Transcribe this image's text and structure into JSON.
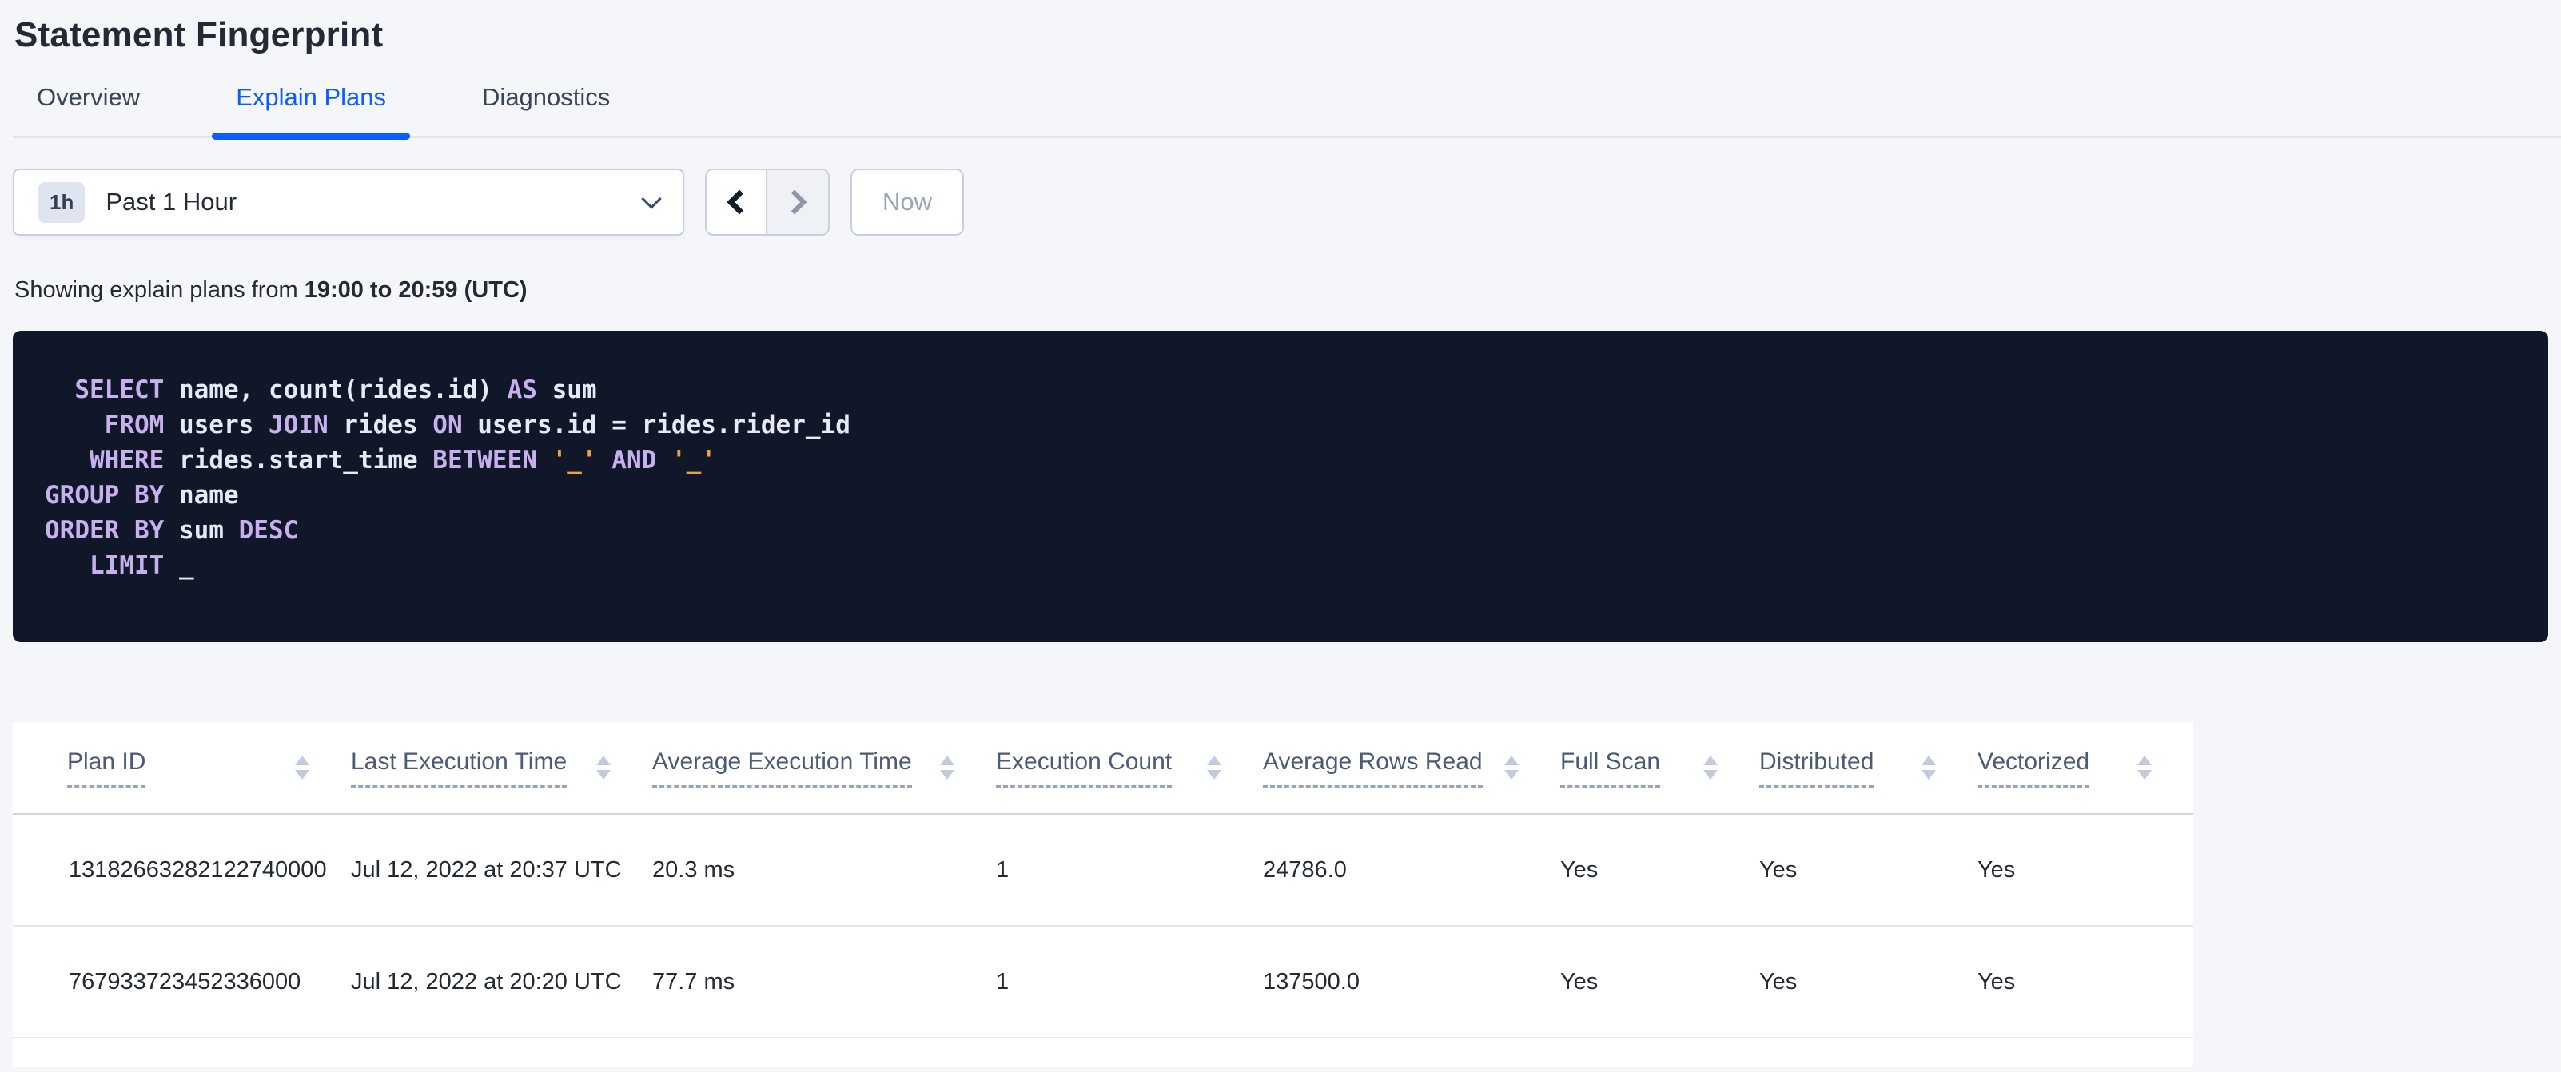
{
  "page": {
    "title": "Statement Fingerprint"
  },
  "tabs": [
    {
      "label": "Overview",
      "active": false
    },
    {
      "label": "Explain Plans",
      "active": true
    },
    {
      "label": "Diagnostics",
      "active": false
    }
  ],
  "time_picker": {
    "badge": "1h",
    "label": "Past 1 Hour",
    "now_label": "Now"
  },
  "subtitle": {
    "prefix": "Showing explain plans from ",
    "range": "19:00 to 20:59 (UTC)"
  },
  "sql": {
    "lines": [
      [
        {
          "t": "  ",
          "c": "pl"
        },
        {
          "t": "SELECT",
          "c": "kw"
        },
        {
          "t": " name, count(rides.id) ",
          "c": "pl"
        },
        {
          "t": "AS",
          "c": "kw"
        },
        {
          "t": " sum",
          "c": "pl"
        }
      ],
      [
        {
          "t": "    ",
          "c": "pl"
        },
        {
          "t": "FROM",
          "c": "kw"
        },
        {
          "t": " users ",
          "c": "pl"
        },
        {
          "t": "JOIN",
          "c": "kw"
        },
        {
          "t": " rides ",
          "c": "pl"
        },
        {
          "t": "ON",
          "c": "kw"
        },
        {
          "t": " users.id = rides.rider_id",
          "c": "pl"
        }
      ],
      [
        {
          "t": "   ",
          "c": "pl"
        },
        {
          "t": "WHERE",
          "c": "kw"
        },
        {
          "t": " rides.start_time ",
          "c": "pl"
        },
        {
          "t": "BETWEEN",
          "c": "kw"
        },
        {
          "t": " ",
          "c": "pl"
        },
        {
          "t": "'_'",
          "c": "lit"
        },
        {
          "t": " ",
          "c": "pl"
        },
        {
          "t": "AND",
          "c": "kw"
        },
        {
          "t": " ",
          "c": "pl"
        },
        {
          "t": "'_'",
          "c": "lit"
        }
      ],
      [
        {
          "t": "GROUP BY",
          "c": "kw"
        },
        {
          "t": " name",
          "c": "pl"
        }
      ],
      [
        {
          "t": "ORDER BY",
          "c": "kw"
        },
        {
          "t": " sum ",
          "c": "pl"
        },
        {
          "t": "DESC",
          "c": "kw"
        }
      ],
      [
        {
          "t": "   ",
          "c": "pl"
        },
        {
          "t": "LIMIT",
          "c": "kw"
        },
        {
          "t": " _",
          "c": "pl"
        }
      ]
    ]
  },
  "table": {
    "columns": [
      "Plan ID",
      "Last Execution Time",
      "Average Execution Time",
      "Execution Count",
      "Average Rows Read",
      "Full Scan",
      "Distributed",
      "Vectorized"
    ],
    "rows": [
      [
        "13182663282122740000",
        "Jul 12, 2022 at 20:37 UTC",
        "20.3 ms",
        "1",
        "24786.0",
        "Yes",
        "Yes",
        "Yes"
      ],
      [
        "767933723452336000",
        "Jul 12, 2022 at 20:20 UTC",
        "77.7 ms",
        "1",
        "137500.0",
        "Yes",
        "Yes",
        "Yes"
      ]
    ]
  },
  "colors": {
    "accent-blue": "#0b5dff",
    "sql-bg": "#0f1729",
    "sql-kw": "#c8b0ee",
    "sql-plain": "#e7e9f4",
    "sql-lit": "#f0a13f"
  }
}
